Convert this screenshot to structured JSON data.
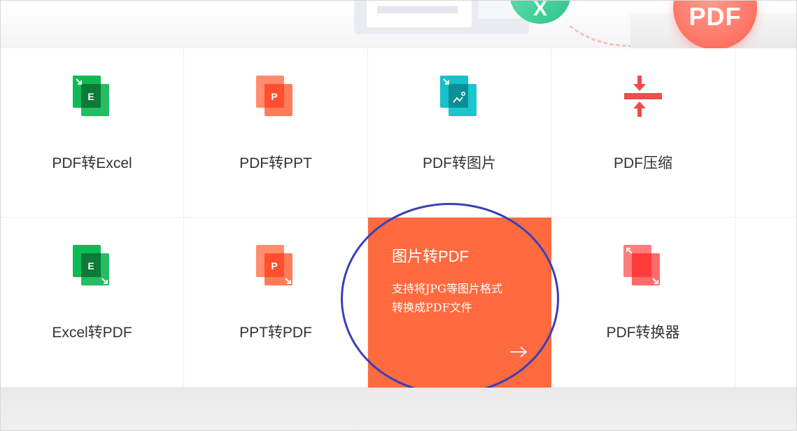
{
  "banner": {
    "badge_letter": "X",
    "pdf_badge": "PDF"
  },
  "colors": {
    "highlight": "#ff6a3e",
    "excel_green": "#0dba54",
    "ppt_orange": "#ff6b4a",
    "image_teal": "#16c1c9",
    "compress_red": "#f24b4b",
    "annotation_circle": "#3a3fb8"
  },
  "tools": [
    {
      "id": "pdf-to-excel",
      "label": "PDF转Excel",
      "icon": "excel-doc-icon"
    },
    {
      "id": "pdf-to-ppt",
      "label": "PDF转PPT",
      "icon": "ppt-doc-icon"
    },
    {
      "id": "pdf-to-image",
      "label": "PDF转图片",
      "icon": "image-doc-icon"
    },
    {
      "id": "pdf-compress",
      "label": "PDF压缩",
      "icon": "compress-icon"
    },
    {
      "id": "excel-to-pdf",
      "label": "Excel转PDF",
      "icon": "excel-doc-icon"
    },
    {
      "id": "ppt-to-pdf",
      "label": "PPT转PDF",
      "icon": "ppt-doc-icon"
    },
    {
      "id": "pdf-converter",
      "label": "PDF转换器",
      "icon": "converter-doc-icon"
    }
  ],
  "highlight_card": {
    "title": "图片转PDF",
    "desc_line1": "支持将JPG等图片格式",
    "desc_line2": "转换成PDF文件",
    "arrow_icon": "arrow-right-icon"
  },
  "icon_letters": {
    "excel": "E",
    "ppt": "P"
  }
}
